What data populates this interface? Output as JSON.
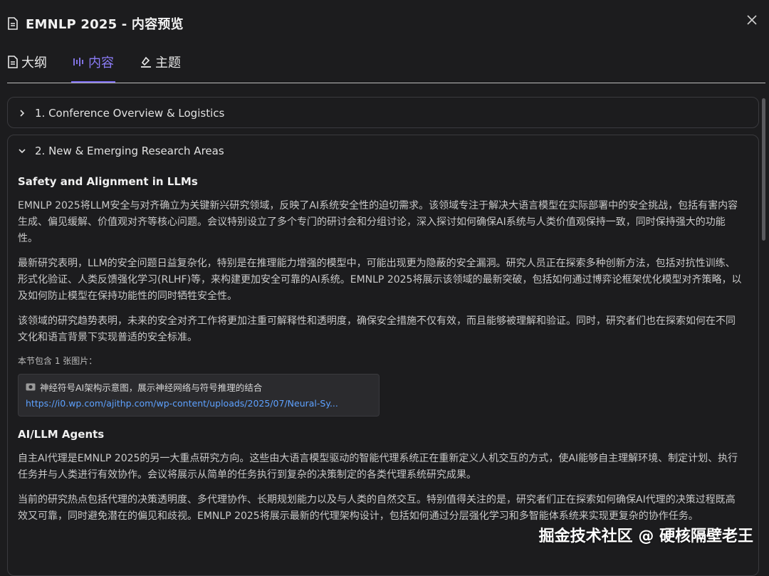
{
  "window": {
    "title": "EMNLP 2025 - 内容预览",
    "close_icon": "close-icon"
  },
  "tabs": [
    {
      "label": "大纲",
      "icon": "outline-doc-icon"
    },
    {
      "label": "内容",
      "icon": "content-icon",
      "active": true
    },
    {
      "label": "主题",
      "icon": "theme-brush-icon"
    }
  ],
  "sections": [
    {
      "label": "1. Conference Overview & Logistics",
      "expanded": false
    },
    {
      "label": "2. New & Emerging Research Areas",
      "expanded": true
    }
  ],
  "content": {
    "safety": {
      "title": "Safety and Alignment in LLMs",
      "p1": "EMNLP 2025将LLM安全与对齐确立为关键新兴研究领域，反映了AI系统安全性的迫切需求。该领域专注于解决大语言模型在实际部署中的安全挑战，包括有害内容生成、偏见缓解、价值观对齐等核心问题。会议特别设立了多个专门的研讨会和分组讨论，深入探讨如何确保AI系统与人类价值观保持一致，同时保持强大的功能性。",
      "p2": "最新研究表明，LLM的安全问题日益复杂化，特别是在推理能力增强的模型中，可能出现更为隐蔽的安全漏洞。研究人员正在探索多种创新方法，包括对抗性训练、形式化验证、人类反馈强化学习(RLHF)等，来构建更加安全可靠的AI系统。EMNLP 2025将展示该领域的最新突破，包括如何通过博弈论框架优化模型对齐策略，以及如何防止模型在保持功能性的同时牺牲安全性。",
      "p3": "该领域的研究趋势表明，未来的安全对齐工作将更加注重可解释性和透明度，确保安全措施不仅有效，而且能够被理解和验证。同时，研究者们也在探索如何在不同文化和语言背景下实现普适的安全标准。",
      "image_count_text": "本节包含 1 张图片：",
      "image_caption": "神经符号AI架构示意图，展示神经网络与符号推理的结合",
      "image_url": "https://i0.wp.com/ajithp.com/wp-content/uploads/2025/07/Neural-Sy..."
    },
    "agents": {
      "title": "AI/LLM Agents",
      "p1": "自主AI代理是EMNLP 2025的另一大重点研究方向。这些由大语言模型驱动的智能代理系统正在重新定义人机交互的方式，使AI能够自主理解环境、制定计划、执行任务并与人类进行有效协作。会议将展示从简单的任务执行到复杂的决策制定的各类代理系统研究成果。",
      "p2": "当前的研究热点包括代理的决策透明度、多代理协作、长期规划能力以及与人类的自然交互。特别值得关注的是，研究者们正在探索如何确保AI代理的决策过程既高效又可靠，同时避免潜在的偏见和歧视。EMNLP 2025将展示最新的代理架构设计，包括如何通过分层强化学习和多智能体系统来实现更复杂的协作任务。"
    }
  },
  "watermark": "掘金技术社区 @ 硬核隔壁老王",
  "colors": {
    "accent": "#8b7cf6",
    "link": "#5da1ff",
    "background": "#1c1c1e"
  }
}
